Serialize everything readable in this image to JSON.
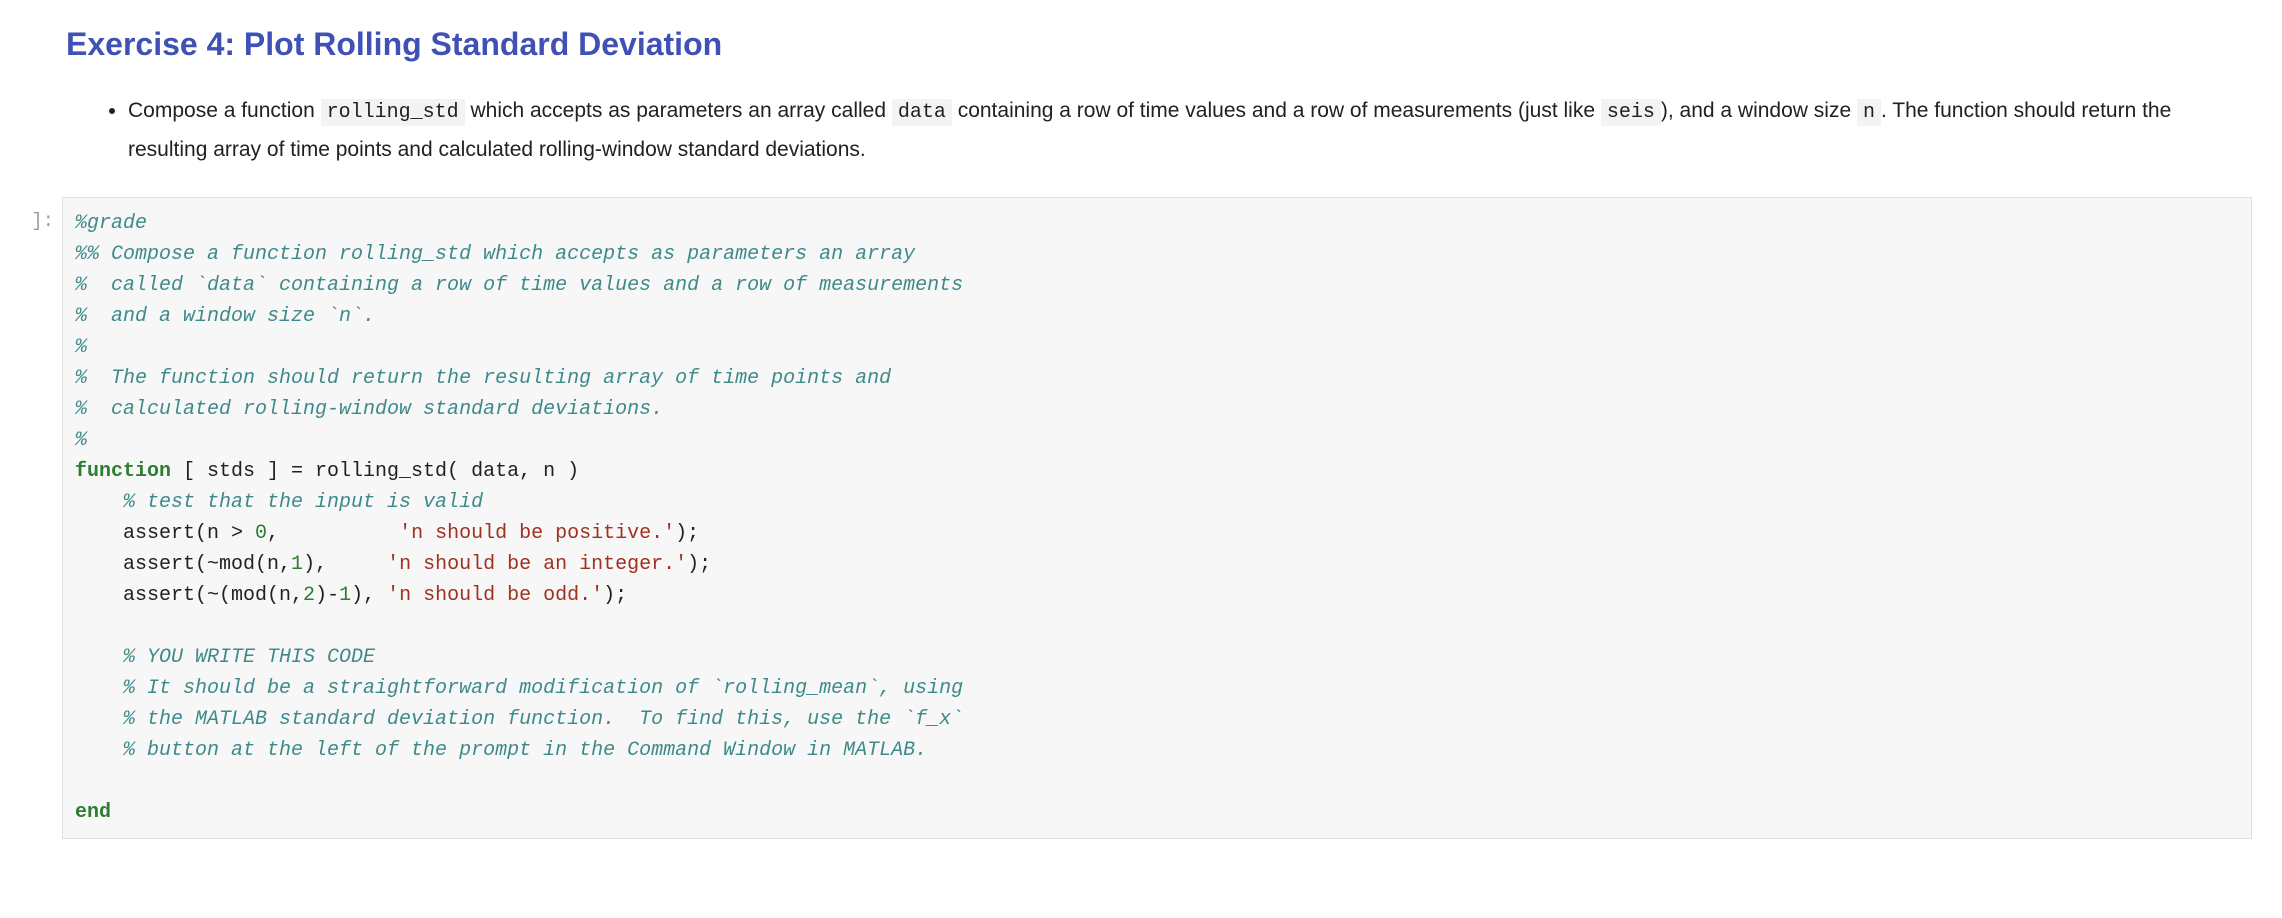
{
  "heading": "Exercise 4: Plot Rolling Standard Deviation",
  "desc": {
    "p1a": "Compose a function ",
    "code1": "rolling_std",
    "p1b": " which accepts as parameters an array called ",
    "code2": "data",
    "p1c": " containing a row of time values and a row of measurements (just like ",
    "code3": "seis",
    "p1d": "), and a window size ",
    "code4": "n",
    "p1e": ". The function should return the resulting array of time points and calculated rolling-window standard deviations."
  },
  "prompt": "]:",
  "code": {
    "l01": "%grade",
    "l02": "%% Compose a function rolling_std which accepts as parameters an array",
    "l03": "%  called `data` containing a row of time values and a row of measurements",
    "l04": "%  and a window size `n`.",
    "l05": "%",
    "l06": "%  The function should return the resulting array of time points and",
    "l07": "%  calculated rolling-window standard deviations.",
    "l08": "%",
    "l09a": "function",
    "l09b": " [ stds ] = rolling_std( data, n )",
    "l10": "    % test that the input is valid",
    "l11a": "    assert(n > ",
    "l11b": "0",
    "l11c": ",          ",
    "l11d": "'n should be positive.'",
    "l11e": ");",
    "l12a": "    assert(~mod(n,",
    "l12b": "1",
    "l12c": "),     ",
    "l12d": "'n should be an integer.'",
    "l12e": ");",
    "l13a": "    assert(~(mod(n,",
    "l13b": "2",
    "l13c": ")-",
    "l13d": "1",
    "l13e": "), ",
    "l13f": "'n should be odd.'",
    "l13g": ");",
    "l14": "    ",
    "l15": "    % YOU WRITE THIS CODE",
    "l16": "    % It should be a straightforward modification of `rolling_mean`, using",
    "l17": "    % the MATLAB standard deviation function.  To find this, use the `f_x`",
    "l18": "    % button at the left of the prompt in the Command Window in MATLAB.",
    "l19": "    ",
    "l20": "end"
  }
}
